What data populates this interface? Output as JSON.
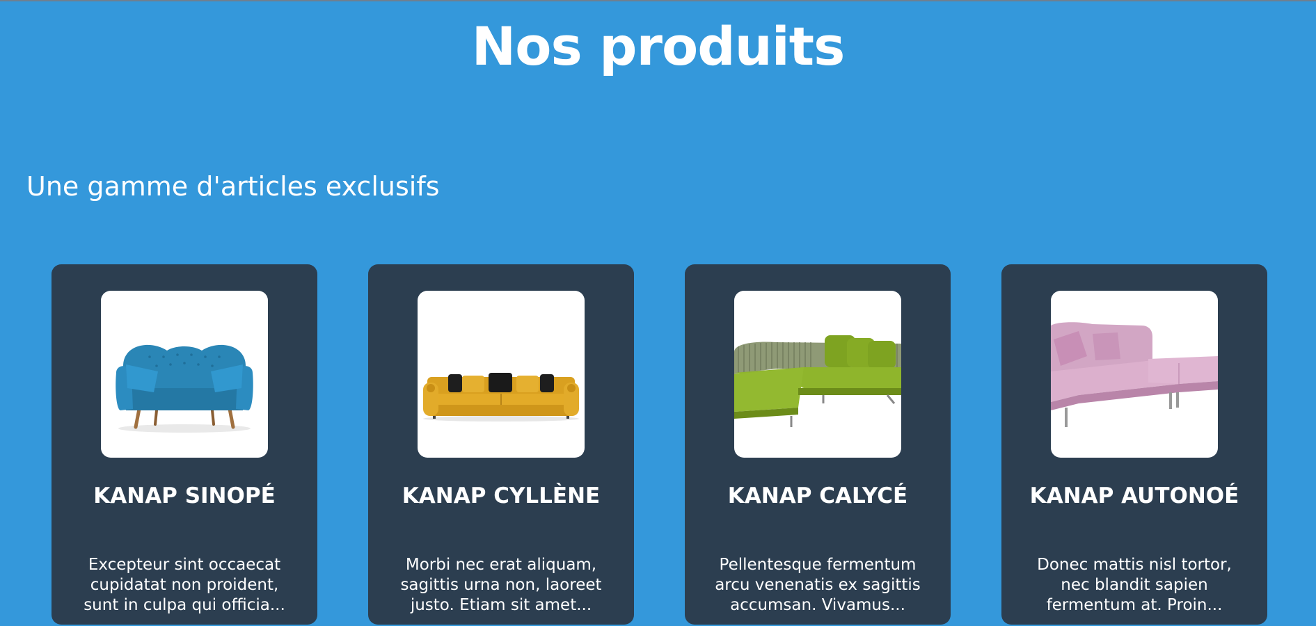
{
  "page": {
    "title": "Nos produits",
    "subtitle": "Une gamme d'articles exclusifs"
  },
  "colors": {
    "background": "#3498db",
    "card": "#2c3e50",
    "text": "#ffffff"
  },
  "products": [
    {
      "name": "KANAP SINOPÉ",
      "description": "Excepteur sint occaecat cupidatat non proident, sunt in culpa qui officia...",
      "image": "blue-sofa-image"
    },
    {
      "name": "KANAP CYLLÈNE",
      "description": "Morbi nec erat aliquam, sagittis urna non, laoreet justo. Etiam sit amet...",
      "image": "yellow-sofa-image"
    },
    {
      "name": "KANAP CALYCÉ",
      "description": "Pellentesque fermentum arcu venenatis ex sagittis accumsan. Vivamus...",
      "image": "green-corner-sofa-image"
    },
    {
      "name": "KANAP AUTONOÉ",
      "description": "Donec mattis nisl tortor, nec blandit sapien fermentum at. Proin...",
      "image": "pink-sofa-image"
    }
  ]
}
